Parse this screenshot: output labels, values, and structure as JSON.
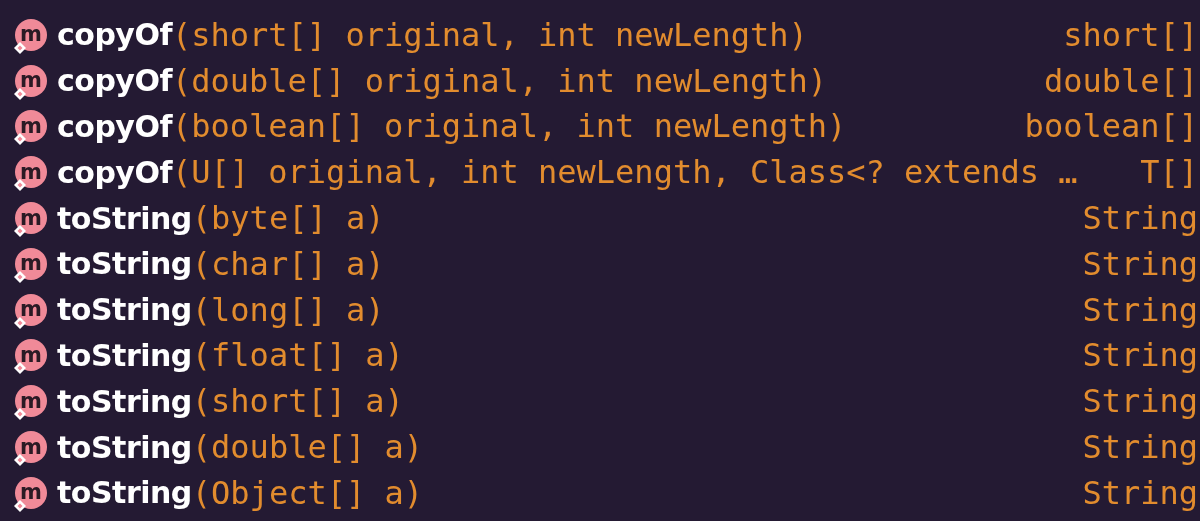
{
  "completion_items": [
    {
      "icon": "m",
      "name": "copyOf",
      "params": "(short[] original, int newLength)",
      "return_type": "short[]"
    },
    {
      "icon": "m",
      "name": "copyOf",
      "params": "(double[] original, int newLength)",
      "return_type": "double[]"
    },
    {
      "icon": "m",
      "name": "copyOf",
      "params": "(boolean[] original, int newLength)",
      "return_type": "boolean[]"
    },
    {
      "icon": "m",
      "name": "copyOf",
      "params": "(U[] original, int newLength, Class<? extends …",
      "return_type": "T[]"
    },
    {
      "icon": "m",
      "name": "toString",
      "params": "(byte[] a)",
      "return_type": "String"
    },
    {
      "icon": "m",
      "name": "toString",
      "params": "(char[] a)",
      "return_type": "String"
    },
    {
      "icon": "m",
      "name": "toString",
      "params": "(long[] a)",
      "return_type": "String"
    },
    {
      "icon": "m",
      "name": "toString",
      "params": "(float[] a)",
      "return_type": "String"
    },
    {
      "icon": "m",
      "name": "toString",
      "params": "(short[] a)",
      "return_type": "String"
    },
    {
      "icon": "m",
      "name": "toString",
      "params": "(double[] a)",
      "return_type": "String"
    },
    {
      "icon": "m",
      "name": "toString",
      "params": "(Object[] a)",
      "return_type": "String"
    }
  ]
}
